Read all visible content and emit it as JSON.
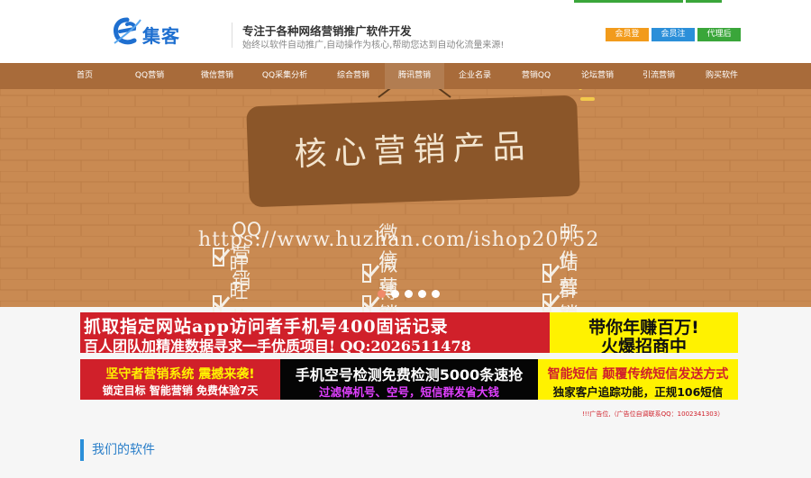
{
  "header": {
    "logo_text": "集客",
    "tagline": "专注于各种网络营销推广软件开发",
    "subtagline": "始终以软件自动推广,自动操作为核心,帮助您达到自动化流量来源!",
    "user_buttons": [
      "会员登陆",
      "会员注册",
      "代理后台"
    ]
  },
  "nav": {
    "items": [
      "首页",
      "QQ营销",
      "微信营销",
      "QQ采集分析",
      "综合营销",
      "腾讯营销",
      "企业名录",
      "营销QQ",
      "论坛营销",
      "引流营销",
      "购买软件"
    ],
    "active_index": 5
  },
  "banner": {
    "title": "核心营销产品",
    "features": [
      "QQ营销",
      "微信营销",
      "邮件营销",
      "旺旺营销",
      "微博营销",
      "站群营销"
    ],
    "watermark": "https://www.huzhan.com/ishop20752",
    "slide_count": 5,
    "active_slide": 0
  },
  "ads": {
    "ad1": {
      "line1": "抓取指定网站app访问者手机号400固话记录",
      "line2": "百人团队加精准数据寻求一手优质项目! QQ:2026511478"
    },
    "ad2": {
      "line1": "带你年赚百万!",
      "line2": "火爆招商中"
    },
    "ad3": {
      "line1": "坚守者营销系统 震撼来袭!",
      "line2": "锁定目标 智能营销 免费体验7天"
    },
    "ad4": {
      "line1": "手机空号检测免费检测5000条速抢",
      "line2": "过滤停机号、空号，短信群发省大钱"
    },
    "ad5": {
      "line1": "智能短信 颠覆传统短信发送方式",
      "line2": "独家客户追踪功能，正规106短信"
    },
    "note": "!!!广告位,（广告位自调联系QQ：1002341303）"
  },
  "section": {
    "title": "我们的软件"
  },
  "colors": {
    "brand": "#1e6fd0",
    "nav_bg": "#a86b3a",
    "banner_bg": "#c8874f",
    "accent_orange": "#f29b1b",
    "accent_blue": "#2b8fd9",
    "accent_green": "#3aa63a"
  }
}
